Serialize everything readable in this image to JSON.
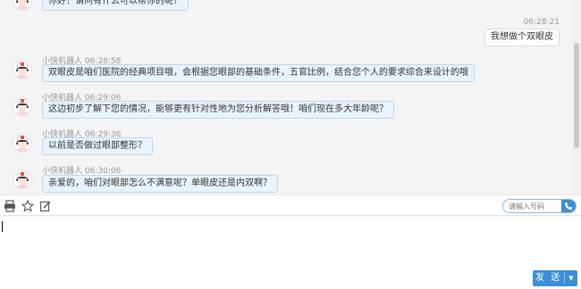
{
  "messages": [
    {
      "id": "m0",
      "side": "left",
      "sender": "",
      "time": "",
      "text": "你好！请问有什么可以帮你的呢？"
    },
    {
      "id": "m1",
      "side": "right",
      "sender": "",
      "time": "06:28:21",
      "text": "我想做个双眼皮"
    },
    {
      "id": "m2",
      "side": "left",
      "sender": "小快机器人",
      "time": "06:28:58",
      "text": "双眼皮是咱们医院的经典项目哦，会根据您眼部的基础条件，五官比例，结合您个人的要求综合来设计的哦"
    },
    {
      "id": "m3",
      "side": "left",
      "sender": "小快机器人",
      "time": "06:29:06",
      "text": "这边初步了解下您的情况，能够更有针对性地为您分析解答哦！咱们现在多大年龄呢？"
    },
    {
      "id": "m4",
      "side": "left",
      "sender": "小快机器人",
      "time": "06:29:36",
      "text": "以前是否做过眼部整形？"
    },
    {
      "id": "m5",
      "side": "left",
      "sender": "小快机器人",
      "time": "06:30:06",
      "text": "亲爱的，咱们对眼部怎么不满意呢？单眼皮还是内双啊？"
    }
  ],
  "toolbar": {
    "icons": [
      "print-icon",
      "star-icon",
      "edit-icon"
    ],
    "phone_placeholder": "请输入号码",
    "call_icon": "phone-icon"
  },
  "composer": {
    "value": "",
    "send_label": "发 送",
    "send_menu_icon": "caret-down-icon"
  },
  "colors": {
    "accent": "#3a8fd6",
    "bubble_left_bg": "#e8f3fc",
    "bubble_left_border": "#b9d9f2",
    "bubble_right_bg": "#ffffff"
  }
}
